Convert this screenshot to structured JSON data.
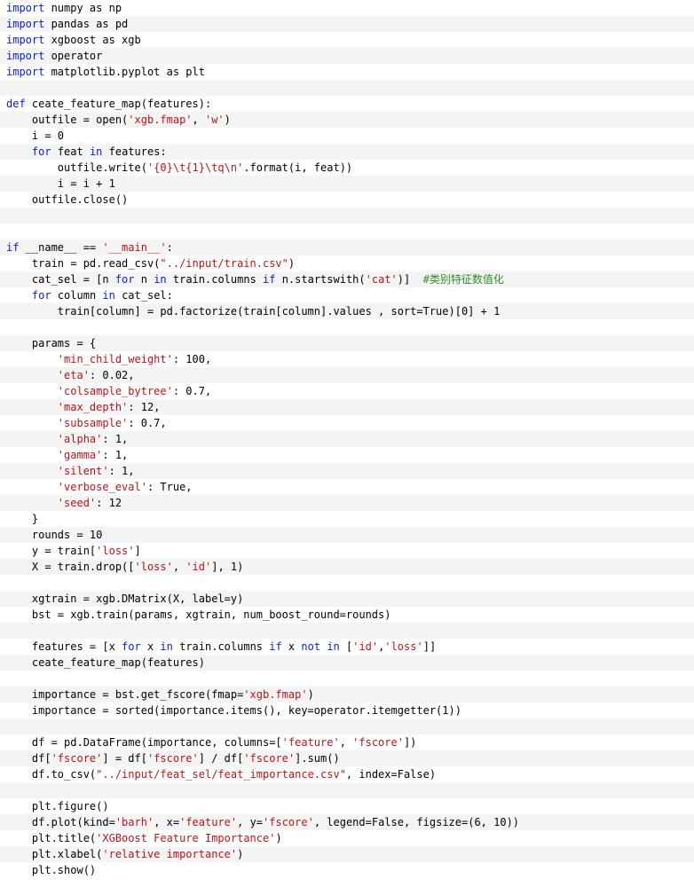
{
  "code_view": {
    "lines": [
      [
        {
          "k": "kw",
          "t": "import"
        },
        {
          "k": "tx",
          "t": " numpy as np"
        }
      ],
      [
        {
          "k": "kw",
          "t": "import"
        },
        {
          "k": "tx",
          "t": " pandas as pd"
        }
      ],
      [
        {
          "k": "kw",
          "t": "import"
        },
        {
          "k": "tx",
          "t": " xgboost as xgb"
        }
      ],
      [
        {
          "k": "kw",
          "t": "import"
        },
        {
          "k": "tx",
          "t": " operator"
        }
      ],
      [
        {
          "k": "kw",
          "t": "import"
        },
        {
          "k": "tx",
          "t": " matplotlib.pyplot as plt"
        }
      ],
      [],
      [
        {
          "k": "kw",
          "t": "def"
        },
        {
          "k": "tx",
          "t": " ceate_feature_map(features):"
        }
      ],
      [
        {
          "k": "tx",
          "t": "    outfile = open("
        },
        {
          "k": "st",
          "t": "'xgb.fmap'"
        },
        {
          "k": "tx",
          "t": ", "
        },
        {
          "k": "st",
          "t": "'w'"
        },
        {
          "k": "tx",
          "t": ")"
        }
      ],
      [
        {
          "k": "tx",
          "t": "    i = 0"
        }
      ],
      [
        {
          "k": "tx",
          "t": "    "
        },
        {
          "k": "kw",
          "t": "for"
        },
        {
          "k": "tx",
          "t": " feat "
        },
        {
          "k": "kw",
          "t": "in"
        },
        {
          "k": "tx",
          "t": " features:"
        }
      ],
      [
        {
          "k": "tx",
          "t": "        outfile.write("
        },
        {
          "k": "st",
          "t": "'{0}\\t{1}\\tq\\n'"
        },
        {
          "k": "tx",
          "t": ".format(i, feat))"
        }
      ],
      [
        {
          "k": "tx",
          "t": "        i = i + 1"
        }
      ],
      [
        {
          "k": "tx",
          "t": "    outfile.close()"
        }
      ],
      [],
      [],
      [
        {
          "k": "kw",
          "t": "if"
        },
        {
          "k": "tx",
          "t": " __name__ == "
        },
        {
          "k": "st",
          "t": "'__main__'"
        },
        {
          "k": "tx",
          "t": ":"
        }
      ],
      [
        {
          "k": "tx",
          "t": "    train = pd.read_csv("
        },
        {
          "k": "st",
          "t": "\"../input/train.csv\""
        },
        {
          "k": "tx",
          "t": ")"
        }
      ],
      [
        {
          "k": "tx",
          "t": "    cat_sel = [n "
        },
        {
          "k": "kw",
          "t": "for"
        },
        {
          "k": "tx",
          "t": " n "
        },
        {
          "k": "kw",
          "t": "in"
        },
        {
          "k": "tx",
          "t": " train.columns "
        },
        {
          "k": "kw",
          "t": "if"
        },
        {
          "k": "tx",
          "t": " n.startswith("
        },
        {
          "k": "st",
          "t": "'cat'"
        },
        {
          "k": "tx",
          "t": ")]  "
        },
        {
          "k": "cm",
          "t": "#类别特征数值化"
        }
      ],
      [
        {
          "k": "tx",
          "t": "    "
        },
        {
          "k": "kw",
          "t": "for"
        },
        {
          "k": "tx",
          "t": " column "
        },
        {
          "k": "kw",
          "t": "in"
        },
        {
          "k": "tx",
          "t": " cat_sel:"
        }
      ],
      [
        {
          "k": "tx",
          "t": "        train[column] = pd.factorize(train[column].values , sort=True)[0] + 1"
        }
      ],
      [],
      [
        {
          "k": "tx",
          "t": "    params = {"
        }
      ],
      [
        {
          "k": "tx",
          "t": "        "
        },
        {
          "k": "st",
          "t": "'min_child_weight'"
        },
        {
          "k": "tx",
          "t": ": 100,"
        }
      ],
      [
        {
          "k": "tx",
          "t": "        "
        },
        {
          "k": "st",
          "t": "'eta'"
        },
        {
          "k": "tx",
          "t": ": 0.02,"
        }
      ],
      [
        {
          "k": "tx",
          "t": "        "
        },
        {
          "k": "st",
          "t": "'colsample_bytree'"
        },
        {
          "k": "tx",
          "t": ": 0.7,"
        }
      ],
      [
        {
          "k": "tx",
          "t": "        "
        },
        {
          "k": "st",
          "t": "'max_depth'"
        },
        {
          "k": "tx",
          "t": ": 12,"
        }
      ],
      [
        {
          "k": "tx",
          "t": "        "
        },
        {
          "k": "st",
          "t": "'subsample'"
        },
        {
          "k": "tx",
          "t": ": 0.7,"
        }
      ],
      [
        {
          "k": "tx",
          "t": "        "
        },
        {
          "k": "st",
          "t": "'alpha'"
        },
        {
          "k": "tx",
          "t": ": 1,"
        }
      ],
      [
        {
          "k": "tx",
          "t": "        "
        },
        {
          "k": "st",
          "t": "'gamma'"
        },
        {
          "k": "tx",
          "t": ": 1,"
        }
      ],
      [
        {
          "k": "tx",
          "t": "        "
        },
        {
          "k": "st",
          "t": "'silent'"
        },
        {
          "k": "tx",
          "t": ": 1,"
        }
      ],
      [
        {
          "k": "tx",
          "t": "        "
        },
        {
          "k": "st",
          "t": "'verbose_eval'"
        },
        {
          "k": "tx",
          "t": ": True,"
        }
      ],
      [
        {
          "k": "tx",
          "t": "        "
        },
        {
          "k": "st",
          "t": "'seed'"
        },
        {
          "k": "tx",
          "t": ": 12"
        }
      ],
      [
        {
          "k": "tx",
          "t": "    }"
        }
      ],
      [
        {
          "k": "tx",
          "t": "    rounds = 10"
        }
      ],
      [
        {
          "k": "tx",
          "t": "    y = train["
        },
        {
          "k": "st",
          "t": "'loss'"
        },
        {
          "k": "tx",
          "t": "]"
        }
      ],
      [
        {
          "k": "tx",
          "t": "    X = train.drop(["
        },
        {
          "k": "st",
          "t": "'loss'"
        },
        {
          "k": "tx",
          "t": ", "
        },
        {
          "k": "st",
          "t": "'id'"
        },
        {
          "k": "tx",
          "t": "], 1)"
        }
      ],
      [],
      [
        {
          "k": "tx",
          "t": "    xgtrain = xgb.DMatrix(X, label=y)"
        }
      ],
      [
        {
          "k": "tx",
          "t": "    bst = xgb.train(params, xgtrain, num_boost_round=rounds)"
        }
      ],
      [],
      [
        {
          "k": "tx",
          "t": "    features = [x "
        },
        {
          "k": "kw",
          "t": "for"
        },
        {
          "k": "tx",
          "t": " x "
        },
        {
          "k": "kw",
          "t": "in"
        },
        {
          "k": "tx",
          "t": " train.columns "
        },
        {
          "k": "kw",
          "t": "if"
        },
        {
          "k": "tx",
          "t": " x "
        },
        {
          "k": "kw",
          "t": "not"
        },
        {
          "k": "tx",
          "t": " "
        },
        {
          "k": "kw",
          "t": "in"
        },
        {
          "k": "tx",
          "t": " ["
        },
        {
          "k": "st",
          "t": "'id'"
        },
        {
          "k": "tx",
          "t": ","
        },
        {
          "k": "st",
          "t": "'loss'"
        },
        {
          "k": "tx",
          "t": "]]"
        }
      ],
      [
        {
          "k": "tx",
          "t": "    ceate_feature_map(features)"
        }
      ],
      [],
      [
        {
          "k": "tx",
          "t": "    importance = bst.get_fscore(fmap="
        },
        {
          "k": "st",
          "t": "'xgb.fmap'"
        },
        {
          "k": "tx",
          "t": ")"
        }
      ],
      [
        {
          "k": "tx",
          "t": "    importance = sorted(importance.items(), key=operator.itemgetter(1))"
        }
      ],
      [],
      [
        {
          "k": "tx",
          "t": "    df = pd.DataFrame(importance, columns=["
        },
        {
          "k": "st",
          "t": "'feature'"
        },
        {
          "k": "tx",
          "t": ", "
        },
        {
          "k": "st",
          "t": "'fscore'"
        },
        {
          "k": "tx",
          "t": "])"
        }
      ],
      [
        {
          "k": "tx",
          "t": "    df["
        },
        {
          "k": "st",
          "t": "'fscore'"
        },
        {
          "k": "tx",
          "t": "] = df["
        },
        {
          "k": "st",
          "t": "'fscore'"
        },
        {
          "k": "tx",
          "t": "] / df["
        },
        {
          "k": "st",
          "t": "'fscore'"
        },
        {
          "k": "tx",
          "t": "].sum()"
        }
      ],
      [
        {
          "k": "tx",
          "t": "    df.to_csv("
        },
        {
          "k": "st",
          "t": "\"../input/feat_sel/feat_importance.csv\""
        },
        {
          "k": "tx",
          "t": ", index=False)"
        }
      ],
      [],
      [
        {
          "k": "tx",
          "t": "    plt.figure()"
        }
      ],
      [
        {
          "k": "tx",
          "t": "    df.plot(kind="
        },
        {
          "k": "st",
          "t": "'barh'"
        },
        {
          "k": "tx",
          "t": ", x="
        },
        {
          "k": "st",
          "t": "'feature'"
        },
        {
          "k": "tx",
          "t": ", y="
        },
        {
          "k": "st",
          "t": "'fscore'"
        },
        {
          "k": "tx",
          "t": ", legend=False, figsize=(6, 10))"
        }
      ],
      [
        {
          "k": "tx",
          "t": "    plt.title("
        },
        {
          "k": "st",
          "t": "'XGBoost Feature Importance'"
        },
        {
          "k": "tx",
          "t": ")"
        }
      ],
      [
        {
          "k": "tx",
          "t": "    plt.xlabel("
        },
        {
          "k": "st",
          "t": "'relative importance'"
        },
        {
          "k": "tx",
          "t": ")"
        }
      ],
      [
        {
          "k": "tx",
          "t": "    plt.show()"
        }
      ]
    ]
  },
  "colors": {
    "keyword": "#0b22c4",
    "string": "#b8141a",
    "comment": "#2e8b2e",
    "text": "#000000",
    "stripe": "#f4f4f4"
  }
}
